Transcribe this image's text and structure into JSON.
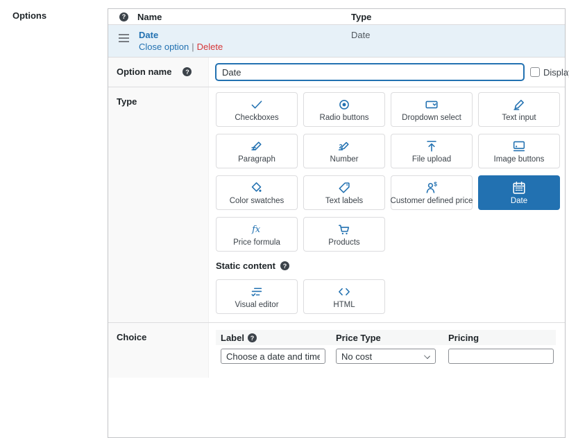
{
  "page": {
    "section_label": "Options"
  },
  "colors": {
    "accent": "#2271b1",
    "link": "#2271b1",
    "delete": "#d63638",
    "row_highlight": "#e7f1f8",
    "selected_card_bg": "#2271b1",
    "label_column_bg": "#f9f9f9"
  },
  "options_table": {
    "name_header": "Name",
    "type_header": "Type",
    "row": {
      "name": "Date",
      "type": "Date",
      "close_action": "Close option",
      "separator": "|",
      "delete_action": "Delete"
    }
  },
  "option_name": {
    "label": "Option name",
    "value": "Date",
    "display_checkbox_label": "Display",
    "checkbox_checked": false
  },
  "type_picker": {
    "label": "Type",
    "selected": "Date",
    "types": [
      {
        "id": "checkboxes",
        "label": "Checkboxes"
      },
      {
        "id": "radio-buttons",
        "label": "Radio buttons"
      },
      {
        "id": "dropdown-select",
        "label": "Dropdown select"
      },
      {
        "id": "text-input",
        "label": "Text input"
      },
      {
        "id": "paragraph",
        "label": "Paragraph"
      },
      {
        "id": "number",
        "label": "Number"
      },
      {
        "id": "file-upload",
        "label": "File upload"
      },
      {
        "id": "image-buttons",
        "label": "Image buttons"
      },
      {
        "id": "color-swatches",
        "label": "Color swatches"
      },
      {
        "id": "text-labels",
        "label": "Text labels"
      },
      {
        "id": "customer-defined-price",
        "label": "Customer defined price"
      },
      {
        "id": "date",
        "label": "Date"
      },
      {
        "id": "price-formula",
        "label": "Price formula"
      },
      {
        "id": "products",
        "label": "Products"
      }
    ],
    "static_content": {
      "heading": "Static content",
      "types": [
        {
          "id": "visual-editor",
          "label": "Visual editor"
        },
        {
          "id": "html",
          "label": "HTML"
        }
      ]
    }
  },
  "choice_section": {
    "label": "Choice",
    "columns": {
      "label": "Label",
      "price_type": "Price Type",
      "pricing": "Pricing"
    },
    "row": {
      "label_value": "Choose a date and time",
      "price_type_value": "No cost",
      "pricing_value": ""
    }
  }
}
